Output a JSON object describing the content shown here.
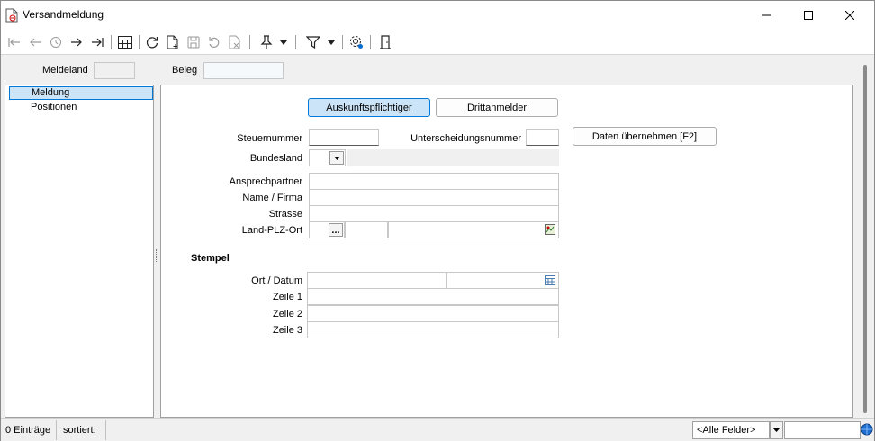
{
  "window": {
    "title": "Versandmeldung"
  },
  "header": {
    "meldeland_label": "Meldeland",
    "meldeland_value": "",
    "beleg_label": "Beleg",
    "beleg_value": ""
  },
  "tree": {
    "items": [
      {
        "label": "Meldung"
      },
      {
        "label": "Positionen"
      }
    ]
  },
  "tabs": [
    {
      "label": "Auskunftspflichtiger"
    },
    {
      "label": "Drittanmelder"
    }
  ],
  "form": {
    "steuernummer_label": "Steuernummer",
    "unterscheidung_label": "Unterscheidungsnummer",
    "daten_button": "Daten übernehmen [F2]",
    "bundesland_label": "Bundesland",
    "ansprech_label": "Ansprechpartner",
    "name_label": "Name / Firma",
    "strasse_label": "Strasse",
    "land_label": "Land-PLZ-Ort",
    "ellipsis": "...",
    "stempel_heading": "Stempel",
    "ort_label": "Ort / Datum",
    "zeile1_label": "Zeile 1",
    "zeile2_label": "Zeile 2",
    "zeile3_label": "Zeile 3"
  },
  "status": {
    "count": "0 Einträge",
    "sorted": "sortiert:",
    "filter_value": "<Alle Felder>"
  },
  "colors": {
    "accent": "#cce4f7",
    "accent_border": "#0078d7"
  }
}
